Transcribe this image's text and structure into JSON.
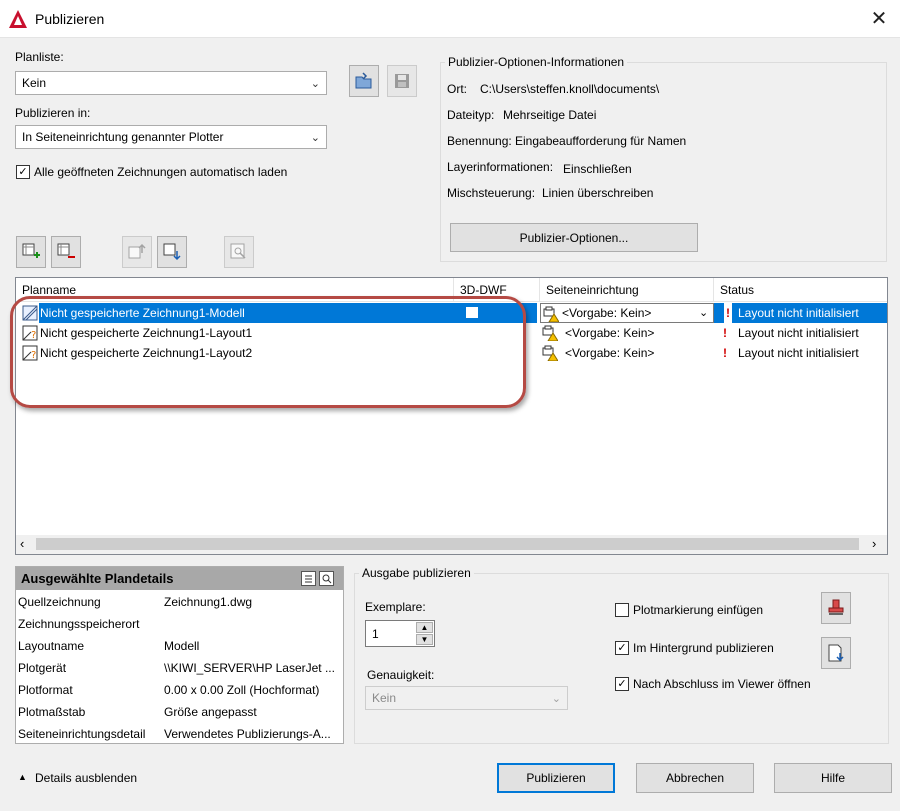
{
  "window": {
    "title": "Publizieren"
  },
  "planliste": {
    "label": "Planliste:",
    "value": "Kein"
  },
  "publizieren_in": {
    "label": "Publizieren in:",
    "value": "In Seiteneinrichtung genannter Plotter"
  },
  "auto_load": {
    "label": "Alle geöffneten Zeichnungen automatisch laden",
    "checked": true
  },
  "options_info": {
    "title": "Publizier-Optionen-Informationen",
    "rows": [
      {
        "label": "Ort:",
        "value": "C:\\Users\\steffen.knoll\\documents\\"
      },
      {
        "label": "Dateityp:",
        "value": "Mehrseitige Datei"
      },
      {
        "label": "Benennung:",
        "value": "Eingabeaufforderung für Namen"
      },
      {
        "label": "Layerinformationen:",
        "value": "Einschließen"
      },
      {
        "label": "Mischsteuerung:",
        "value": "Linien überschreiben"
      }
    ],
    "button": "Publizier-Optionen..."
  },
  "list": {
    "headers": {
      "name": "Planname",
      "dwf": "3D-DWF",
      "setup": "Seiteneinrichtung",
      "status": "Status"
    },
    "rows": [
      {
        "name": "Nicht gespeicherte Zeichnung1-Modell",
        "setup": "<Vorgabe: Kein>",
        "status": "Layout nicht initialisiert",
        "selected": true
      },
      {
        "name": "Nicht gespeicherte Zeichnung1-Layout1",
        "setup": "<Vorgabe: Kein>",
        "status": "Layout nicht initialisiert",
        "selected": false
      },
      {
        "name": "Nicht gespeicherte Zeichnung1-Layout2",
        "setup": "<Vorgabe: Kein>",
        "status": "Layout nicht initialisiert",
        "selected": false
      }
    ],
    "status_mark": "!"
  },
  "details": {
    "title": "Ausgewählte Plandetails",
    "rows": [
      {
        "label": "Quellzeichnung",
        "value": "Zeichnung1.dwg"
      },
      {
        "label": "Zeichnungsspeicherort",
        "value": ""
      },
      {
        "label": "Layoutname",
        "value": "Modell"
      },
      {
        "label": "Plotgerät",
        "value": "\\\\KIWI_SERVER\\HP LaserJet ..."
      },
      {
        "label": "Plotformat",
        "value": "0.00 x 0.00 Zoll (Hochformat)"
      },
      {
        "label": "Plotmaßstab",
        "value": "Größe angepasst"
      },
      {
        "label": "Seiteneinrichtungsdetail",
        "value": "Verwendetes Publizierungs-A..."
      }
    ]
  },
  "output": {
    "title": "Ausgabe publizieren",
    "copies_label": "Exemplare:",
    "copies_value": "1",
    "precision_label": "Genauigkeit:",
    "precision_value": "Kein",
    "plotstamp": {
      "label": "Plotmarkierung einfügen",
      "checked": false
    },
    "background": {
      "label": "Im Hintergrund publizieren",
      "checked": true
    },
    "viewer": {
      "label": "Nach Abschluss im Viewer öffnen",
      "checked": true
    }
  },
  "footer": {
    "details_toggle": "Details ausblenden",
    "publish": "Publizieren",
    "cancel": "Abbrechen",
    "help": "Hilfe"
  },
  "colors": {
    "selection": "#0078d7",
    "highlight_box": "#b54a44",
    "status_icon": "#d00000"
  }
}
